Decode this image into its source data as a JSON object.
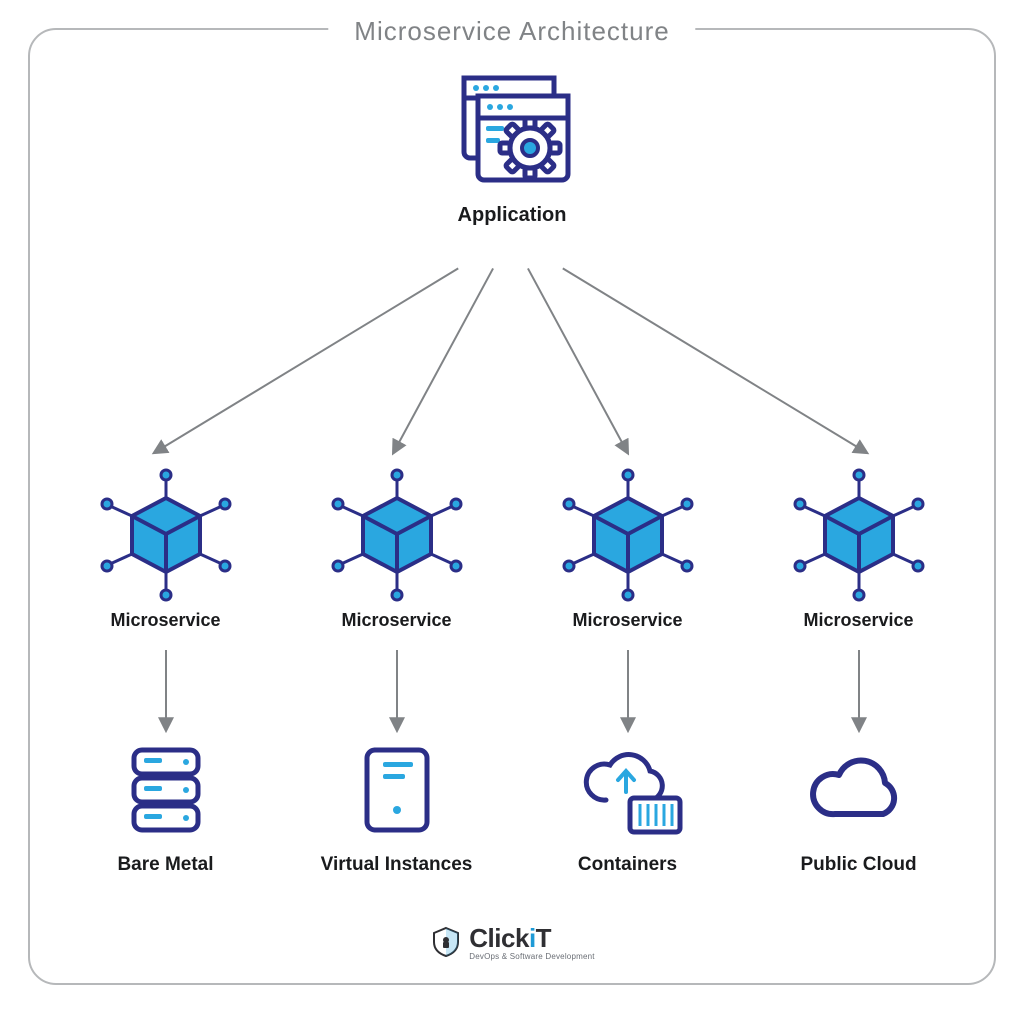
{
  "title": "Microservice Architecture",
  "application": {
    "label": "Application"
  },
  "microservices": [
    {
      "label": "Microservice"
    },
    {
      "label": "Microservice"
    },
    {
      "label": "Microservice"
    },
    {
      "label": "Microservice"
    }
  ],
  "infra": [
    {
      "label": "Bare Metal",
      "icon": "server-stack"
    },
    {
      "label": "Virtual Instances",
      "icon": "vm-window"
    },
    {
      "label": "Containers",
      "icon": "cloud-container"
    },
    {
      "label": "Public Cloud",
      "icon": "cloud"
    }
  ],
  "logo": {
    "brand_main": "Click",
    "brand_accent": "i",
    "brand_suffix": "T",
    "tagline": "DevOps & Software Development"
  },
  "colors": {
    "outline": "#2b2e87",
    "fill": "#2aa7e0",
    "text": "#1a1b1d",
    "arrow": "#808386"
  }
}
